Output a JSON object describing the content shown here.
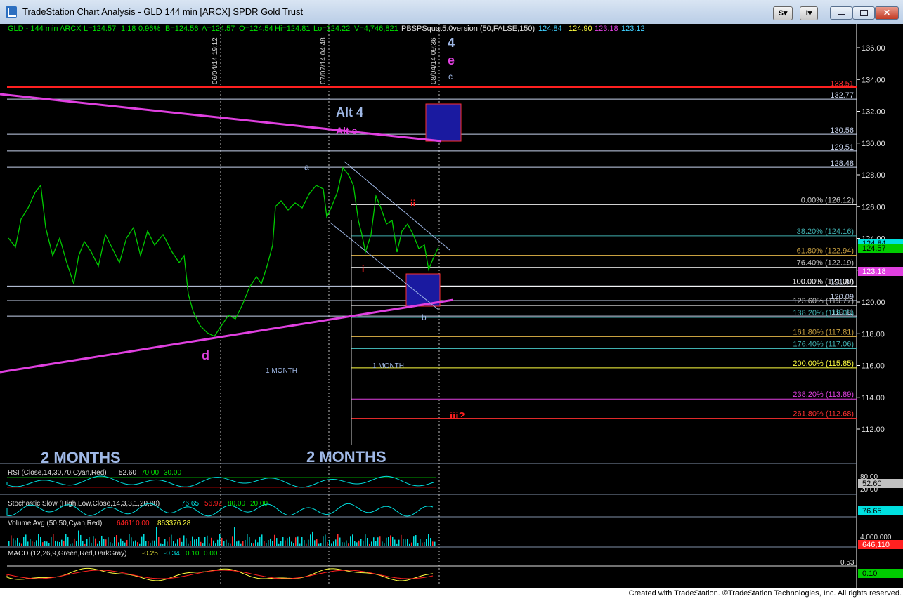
{
  "window": {
    "title": "TradeStation Chart Analysis - GLD 144 min [ARCX] SPDR Gold Trust",
    "toolbar_s": "S",
    "toolbar_i": "I"
  },
  "header": {
    "symbol": "GLD - 144 min",
    "exchange": "ARCX",
    "last": "L=124.57",
    "change": "1.18",
    "pct": "0.96%",
    "bid": "B=124.56",
    "ask": "A=124.57",
    "open": "O=124.54",
    "high": "Hi=124.81",
    "low": "Lo=124.22",
    "volume": "V=4,746,821",
    "study": "PBSPSquat5.0version (50,FALSE,150)",
    "study_values": [
      "124.84",
      "124.90",
      "123.18",
      "123.12"
    ]
  },
  "colors": {
    "price": "#00cc00",
    "trendline": "#e040e0",
    "red": "#ff0000",
    "box": "#1a1aa0",
    "label_blue": "#9fb8e6",
    "axis_text": "#e0e0e0"
  },
  "price_axis": [
    "136.00",
    "134.00",
    "132.00",
    "130.00",
    "128.00",
    "126.00",
    "124.00",
    "122.00",
    "120.00",
    "118.00",
    "116.00",
    "114.00",
    "112.00"
  ],
  "price_badges": {
    "last": "124.57",
    "upper": "124.84",
    "lower": "123.18"
  },
  "levels": [
    {
      "label": "133.51",
      "price": 133.51,
      "color": "#ff2020"
    },
    {
      "label": "132.77",
      "price": 132.77,
      "color": "#c8d4ee"
    },
    {
      "label": "130.56",
      "price": 130.56,
      "color": "#c8d4ee"
    },
    {
      "label": "129.51",
      "price": 129.51,
      "color": "#c8d4ee"
    },
    {
      "label": "128.48",
      "price": 128.48,
      "color": "#c8d4ee"
    },
    {
      "label": "120.09",
      "price": 120.09,
      "color": "#c8d4ee"
    },
    {
      "label": "119.11",
      "price": 119.11,
      "color": "#c8d4ee"
    },
    {
      "label": "121.00",
      "price": 121.0,
      "color": "#c8d4ee"
    }
  ],
  "fibs": [
    {
      "label": "0.00% (126.12)",
      "price": 126.12,
      "color": "#d0d0d0"
    },
    {
      "label": "38.20% (124.16)",
      "price": 124.16,
      "color": "#40b0b0"
    },
    {
      "label": "61.80% (122.94)",
      "price": 122.94,
      "color": "#c8a040"
    },
    {
      "label": "76.40% (122.19)",
      "price": 122.19,
      "color": "#c0c0c0"
    },
    {
      "label": "100.00% (121.00)",
      "price": 121.0,
      "color": "#ffffff"
    },
    {
      "label": "123.60% (119.77)",
      "price": 119.77,
      "color": "#c0c0c0"
    },
    {
      "label": "138.20% (119.03)",
      "price": 119.03,
      "color": "#40b0b0"
    },
    {
      "label": "161.80% (117.81)",
      "price": 117.81,
      "color": "#c8a040"
    },
    {
      "label": "176.40% (117.06)",
      "price": 117.06,
      "color": "#40b0b0"
    },
    {
      "label": "200.00% (115.85)",
      "price": 115.85,
      "color": "#ffff40"
    },
    {
      "label": "238.20% (113.89)",
      "price": 113.89,
      "color": "#e040e0"
    },
    {
      "label": "261.80% (112.68)",
      "price": 112.68,
      "color": "#ff3030"
    }
  ],
  "dates": [
    "06/04/14 19:12",
    "07/07/14 04:48",
    "08/04/14 09:36"
  ],
  "annotations": {
    "wave4": "4",
    "wave_e": "e",
    "wave_c": "c",
    "alt4": "Alt 4",
    "alte": "Alt e",
    "d_label": "d",
    "a_label": "a",
    "b_label": "b",
    "ii_label": "ii",
    "iii_label": "iii?",
    "i_label": "i",
    "one_month_left": "1 MONTH",
    "one_month_right": "1 MONTH",
    "two_months_left": "2 MONTHS",
    "two_months_right": "2 MONTHS"
  },
  "indicators": {
    "rsi": {
      "label": "RSI (Close,14,30,70,Cyan,Red)",
      "v1": "52.60",
      "v2": "70.00",
      "v3": "30.00",
      "axis_top": "80.00",
      "axis_bottom": "20.00",
      "badge": "52.60"
    },
    "stoch": {
      "label": "Stochastic Slow (High,Low,Close,14,3,3,1,20,80)",
      "v1": "76.65",
      "v2": "56.92",
      "v3": "80.00",
      "v4": "20.00",
      "badge": "76.65"
    },
    "volume": {
      "label": "Volume Avg (50,50,Cyan,Red)",
      "v1": "646110.00",
      "v2": "863376.28",
      "axis": "4,000.000",
      "badge": "646,110"
    },
    "macd": {
      "label": "MACD (12,26,9,Green,Red,DarkGray)",
      "v1": "-0.25",
      "v2": "-0.34",
      "v3": "0.10",
      "v4": "0.00",
      "axis": "0.53",
      "badge": "0.10"
    }
  },
  "footer": "Created with TradeStation. ©TradeStation Technologies, Inc. All rights reserved."
}
